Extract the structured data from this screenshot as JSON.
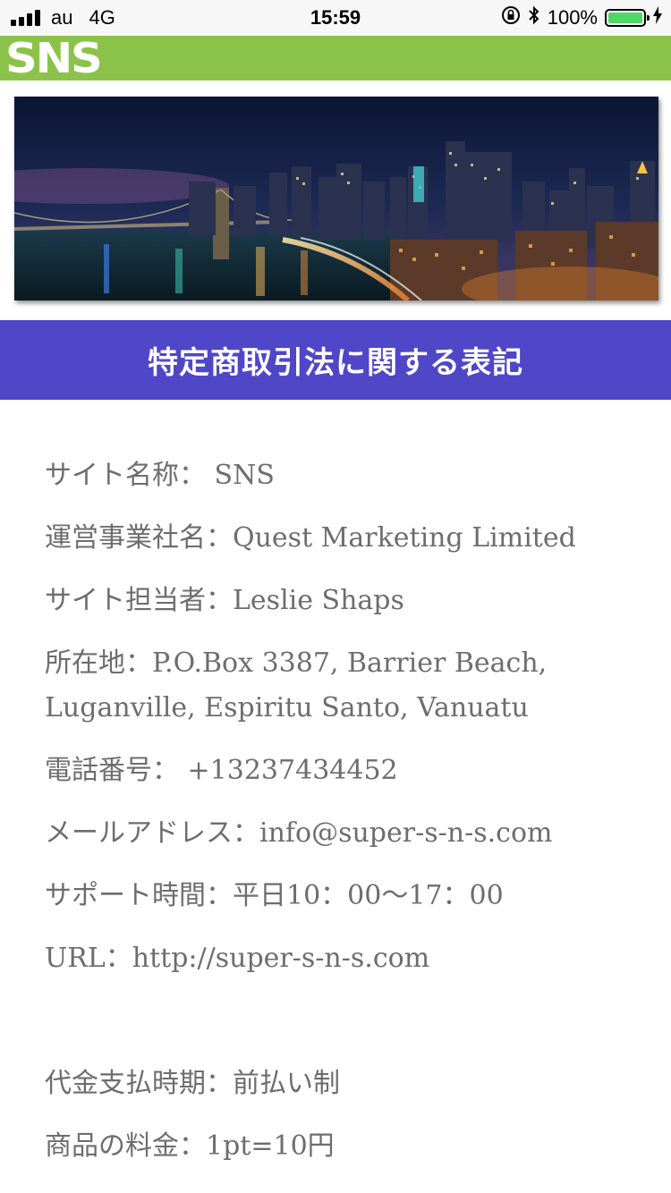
{
  "status_bar": {
    "carrier": "au",
    "network": "4G",
    "time": "15:59",
    "battery_percent": "100%",
    "battery_level": 1.0
  },
  "header": {
    "logo_text": "SNS"
  },
  "banner": {
    "image": "city-skyline-night-photo"
  },
  "title": "特定商取引法に関する表記",
  "details": [
    "サイト名称： SNS",
    "運営事業社名：Quest Marketing Limited",
    "サイト担当者：Leslie Shaps",
    "所在地：P.O.Box 3387, Barrier Beach, Luganville, Espiritu Santo, Vanuatu",
    "電話番号： +13237434452",
    "メールアドレス：info@super-s-n-s.com",
    "サポート時間：平日10：00〜17：00",
    "URL：http://super-s-n-s.com"
  ],
  "details_2": [
    "代金支払時期：前払い制",
    "商品の料金：1pt=10円"
  ],
  "colors": {
    "brand_green": "#8bc34a",
    "title_bar": "#5046c8",
    "text_gray": "#6d6d6d",
    "battery_green": "#4cd964"
  }
}
